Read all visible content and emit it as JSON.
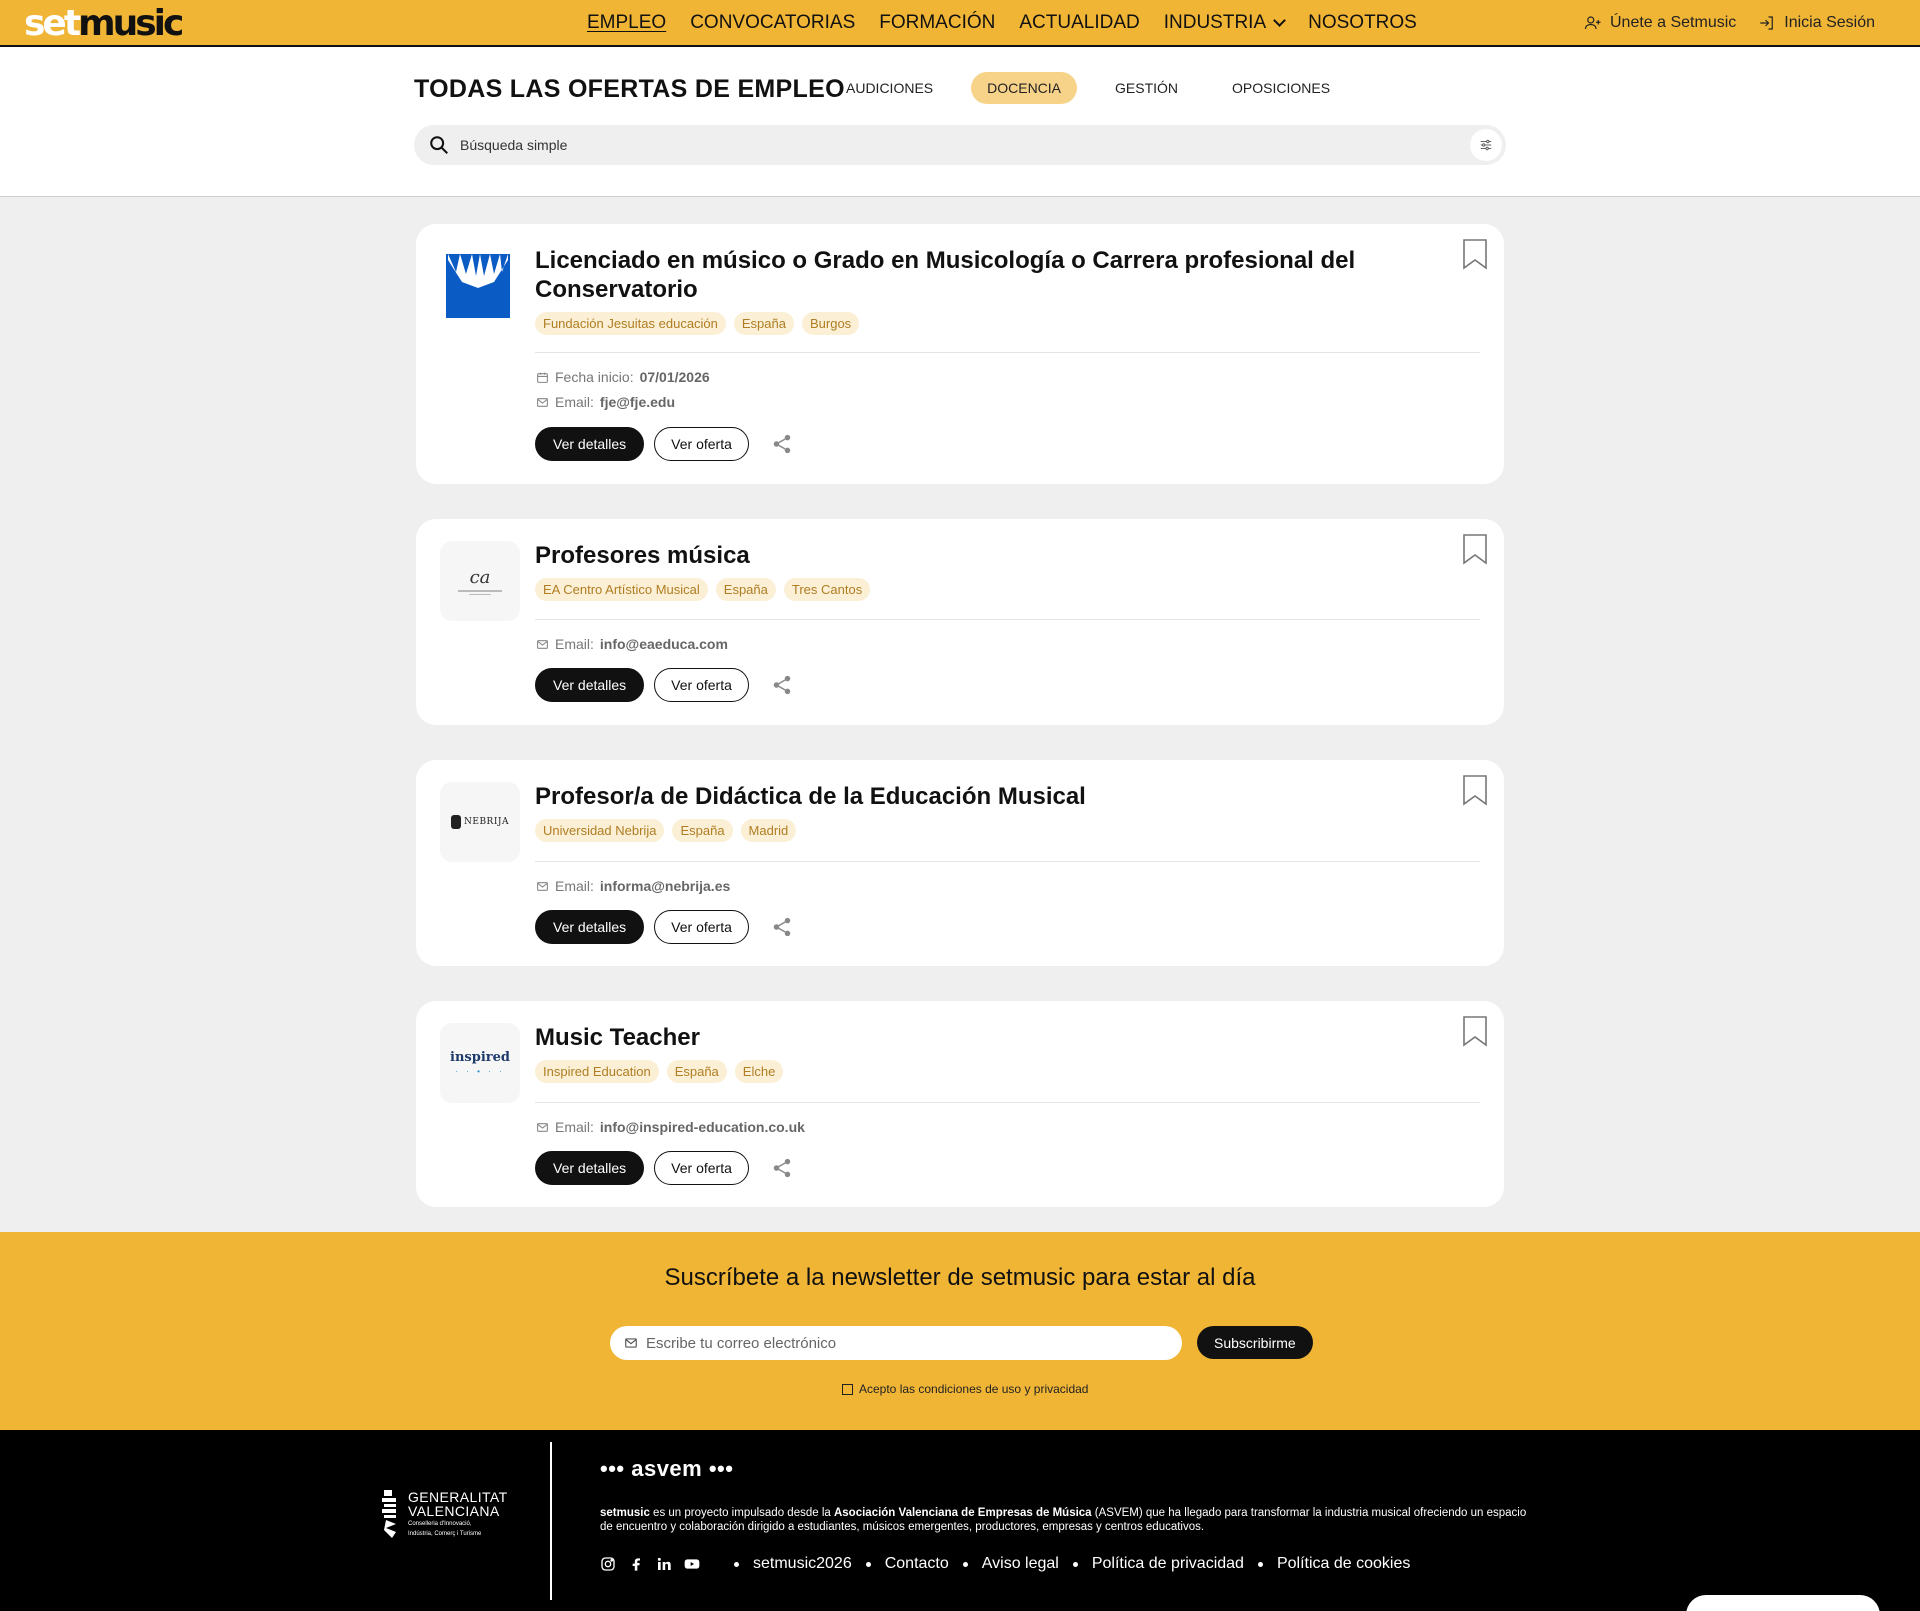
{
  "header": {
    "logo_a": "set",
    "logo_b": "music",
    "nav": [
      "EMPLEO",
      "CONVOCATORIAS",
      "FORMACIÓN",
      "ACTUALIDAD",
      "INDUSTRIA",
      "NOSOTROS"
    ],
    "join_label": "Únete a Setmusic",
    "login_label": "Inicia Sesión"
  },
  "page": {
    "title": "TODAS LAS OFERTAS DE EMPLEO",
    "categories": [
      "AUDICIONES",
      "DOCENCIA",
      "GESTIÓN",
      "OPOSICIONES"
    ],
    "active_category": "DOCENCIA",
    "search_placeholder": "Búsqueda simple"
  },
  "labels": {
    "start_date": "Fecha inicio:",
    "email": "Email:",
    "details_btn": "Ver detalles",
    "offer_btn": "Ver oferta"
  },
  "jobs": [
    {
      "title": "Licenciado en músico o Grado en Musicología o Carrera profesional del Conservatorio",
      "tags": [
        "Fundación Jesuitas educación",
        "España",
        "Burgos"
      ],
      "start_date": "07/01/2026",
      "email": "fje@fje.edu"
    },
    {
      "title": "Profesores música",
      "tags": [
        "EA Centro Artístico Musical",
        "España",
        "Tres Cantos"
      ],
      "email": "info@eaeduca.com"
    },
    {
      "title": "Profesor/a de Didáctica de la Educación Musical",
      "tags": [
        "Universidad Nebrija",
        "España",
        "Madrid"
      ],
      "email": "informa@nebrija.es"
    },
    {
      "title": "Music Teacher",
      "tags": [
        "Inspired Education",
        "España",
        "Elche"
      ],
      "email": "info@inspired-education.co.uk"
    }
  ],
  "logos": {
    "ea": "ca",
    "nebrija": "NEBRIJA",
    "inspired": "inspired"
  },
  "newsletter": {
    "title": "Suscríbete a la newsletter de setmusic para estar al día",
    "placeholder": "Escribe tu correo electrónico",
    "button": "Subscribirme",
    "consent": "Acepto las condiciones de uso y privacidad"
  },
  "footer": {
    "gv_line1": "GENERALITAT",
    "gv_line2": "VALENCIANA",
    "gv_small1": "Conselleria d'Innovació,",
    "gv_small2": "Indústria, Comerç i Turisme",
    "asvem": "••• asvem •••",
    "about_brand": "setmusic",
    "about_mid": " es un proyecto impulsado desde la ",
    "about_assoc": "Asociación Valenciana de Empresas de Música",
    "about_rest": " (ASVEM) que ha llegado para transformar la industria musical ofreciendo un espacio de encuentro y colaboración dirigido a estudiantes, músicos emergentes, productores, empresas y centros educativos.",
    "links": [
      "setmusic2026",
      "Contacto",
      "Aviso legal",
      "Política de privacidad",
      "Política de cookies"
    ]
  }
}
